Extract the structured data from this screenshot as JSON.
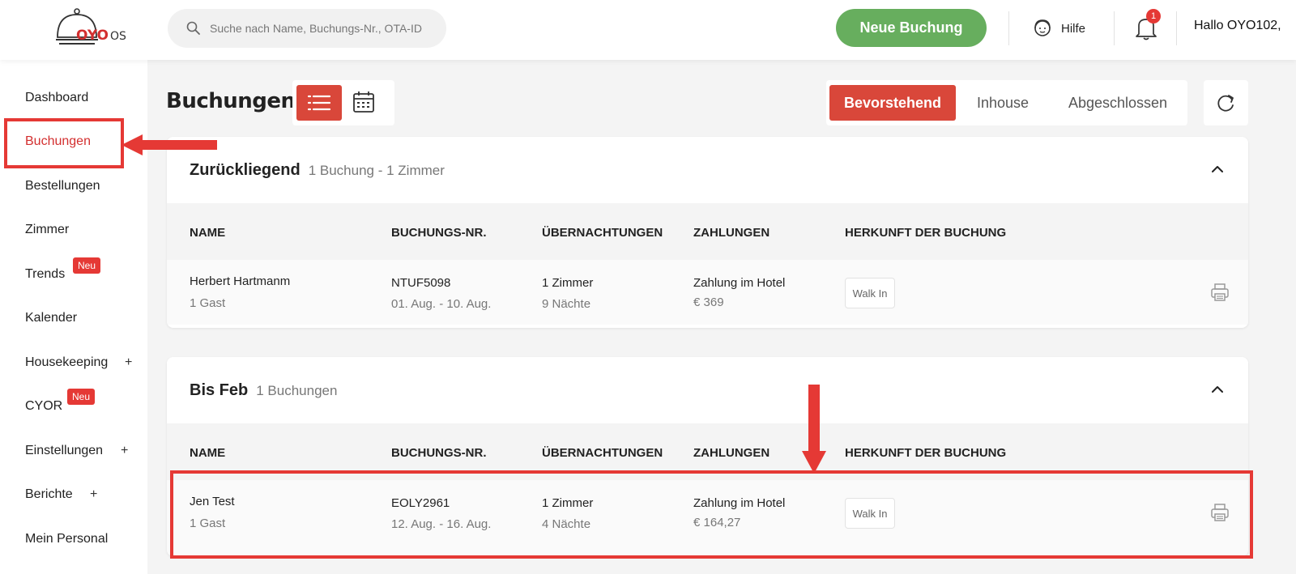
{
  "header": {
    "logo_main": "OYO",
    "logo_suffix": "OS",
    "search_placeholder": "Suche nach Name, Buchungs-Nr., OTA-ID",
    "new_booking_label": "Neue Buchung",
    "help_label": "Hilfe",
    "notification_count": "1",
    "greeting": "Hallo OYO102,"
  },
  "sidebar": {
    "items": [
      {
        "label": "Dashboard"
      },
      {
        "label": "Buchungen"
      },
      {
        "label": "Bestellungen"
      },
      {
        "label": "Zimmer"
      },
      {
        "label": "Trends",
        "badge": "Neu"
      },
      {
        "label": "Kalender"
      },
      {
        "label": "Housekeeping",
        "expand": "+"
      },
      {
        "label": "CYOR",
        "badge": "Neu"
      },
      {
        "label": "Einstellungen",
        "expand": "+"
      },
      {
        "label": "Berichte",
        "expand": "+"
      },
      {
        "label": "Mein Personal"
      }
    ]
  },
  "main": {
    "page_title": "Buchungen",
    "tabs": [
      {
        "label": "Bevorstehend"
      },
      {
        "label": "Inhouse"
      },
      {
        "label": "Abgeschlossen"
      }
    ],
    "columns": [
      "NAME",
      "BUCHUNGS-NR.",
      "ÜBERNACHTUNGEN",
      "ZAHLUNGEN",
      "HERKUNFT DER BUCHUNG"
    ],
    "groups": [
      {
        "title": "Zurückliegend",
        "subtitle": "1 Buchung - 1 Zimmer",
        "rows": [
          {
            "name": "Herbert Hartmanm",
            "guests": "1 Gast",
            "booking_no": "NTUF5098",
            "dates": "01. Aug. - 10. Aug.",
            "rooms": "1 Zimmer",
            "nights": "9 Nächte",
            "payment": "Zahlung im Hotel",
            "amount": "€ 369",
            "source": "Walk In"
          }
        ]
      },
      {
        "title": "Bis Feb",
        "subtitle": "1 Buchungen",
        "rows": [
          {
            "name": "Jen Test",
            "guests": "1 Gast",
            "booking_no": "EOLY2961",
            "dates": "12. Aug. - 16. Aug.",
            "rooms": "1 Zimmer",
            "nights": "4 Nächte",
            "payment": "Zahlung im Hotel",
            "amount": "€ 164,27",
            "source": "Walk In"
          }
        ]
      }
    ]
  },
  "colors": {
    "brand_red": "#d9473a",
    "cta_green": "#67ae5e",
    "annotation_red": "#e53935"
  }
}
